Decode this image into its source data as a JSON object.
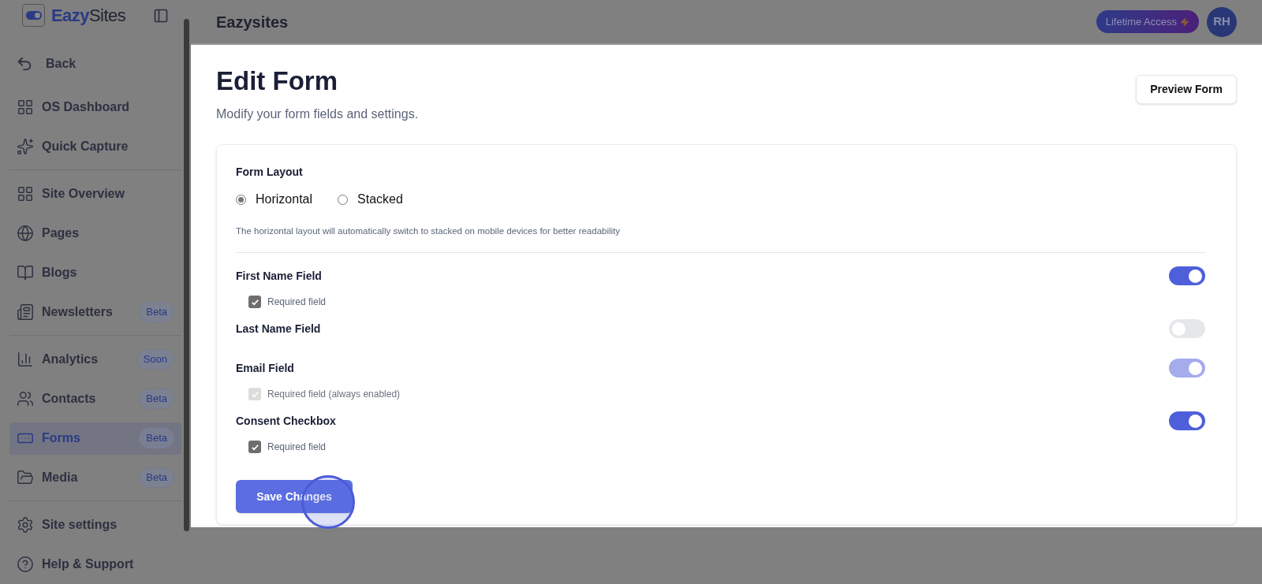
{
  "sidebar": {
    "logo": {
      "prefix": "Eazy",
      "suffix": "Sites"
    },
    "back": "Back",
    "groups": [
      [
        {
          "label": "OS Dashboard",
          "selected": false
        },
        {
          "label": "Quick Capture",
          "selected": false
        }
      ],
      [
        {
          "label": "Site Overview",
          "selected": false
        },
        {
          "label": "Pages",
          "selected": false
        },
        {
          "label": "Blogs",
          "selected": false
        },
        {
          "label": "Newsletters",
          "badge": "Beta",
          "selected": false
        }
      ],
      [
        {
          "label": "Analytics",
          "badge": "Soon",
          "selected": false
        },
        {
          "label": "Contacts",
          "badge": "Beta",
          "selected": false
        },
        {
          "label": "Forms",
          "badge": "Beta",
          "selected": true
        },
        {
          "label": "Media",
          "badge": "Beta",
          "selected": false
        }
      ],
      [
        {
          "label": "Site settings",
          "selected": false
        },
        {
          "label": "Help & Support",
          "selected": false
        }
      ]
    ]
  },
  "header": {
    "title": "Eazysites",
    "plan": "Lifetime Access",
    "avatar": "RH"
  },
  "page": {
    "title": "Edit Form",
    "subtitle": "Modify your form fields and settings.",
    "preview_button": "Preview Form"
  },
  "form": {
    "layout_label": "Form Layout",
    "layouts": [
      {
        "label": "Horizontal",
        "selected": true
      },
      {
        "label": "Stacked",
        "selected": false
      }
    ],
    "layout_hint": "The horizontal layout will automatically switch to stacked on mobile devices for better readability",
    "fields": [
      {
        "label": "First Name Field",
        "on": true,
        "disabled": false,
        "required": {
          "label": "Required field",
          "checked": true,
          "disabled": false
        }
      },
      {
        "label": "Last Name Field",
        "on": false,
        "disabled": false
      },
      {
        "label": "Email Field",
        "on": true,
        "disabled": true,
        "required": {
          "label": "Required field (always enabled)",
          "checked": true,
          "disabled": true
        }
      },
      {
        "label": "Consent Checkbox",
        "on": true,
        "disabled": false,
        "required": {
          "label": "Required field",
          "checked": true,
          "disabled": false
        }
      }
    ],
    "save_button": "Save Changes"
  }
}
